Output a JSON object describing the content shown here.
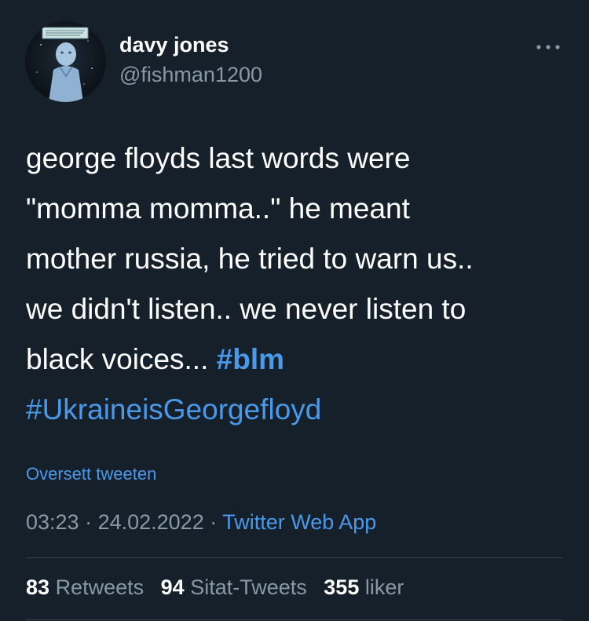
{
  "author": {
    "display_name": "davy jones",
    "handle": "@fishman1200",
    "avatar_icon": "comic-figure-avatar"
  },
  "more_icon": "more-horizontal-icon",
  "tweet": {
    "text_parts": {
      "line1": "george floyds last words were",
      "line2": "\"momma momma..\" he meant",
      "line3": "mother russia, he tried to warn us..",
      "line4": "we didn't listen.. we never listen to",
      "line5": "black voices... ",
      "hashtag1": "#blm",
      "hashtag2": "#UkraineisGeorgefloyd"
    }
  },
  "translate_label": "Oversett tweeten",
  "meta": {
    "time": "03:23",
    "separator1": " · ",
    "date": "24.02.2022",
    "separator2": " · ",
    "source": "Twitter Web App"
  },
  "stats": {
    "retweets_count": "83",
    "retweets_label": "Retweets",
    "quotes_count": "94",
    "quotes_label": "Sitat-Tweets",
    "likes_count": "355",
    "likes_label": "liker"
  },
  "colors": {
    "background": "#15202b",
    "link": "#4a99e9",
    "secondary_text": "#8899a6",
    "divider": "#38444d"
  }
}
